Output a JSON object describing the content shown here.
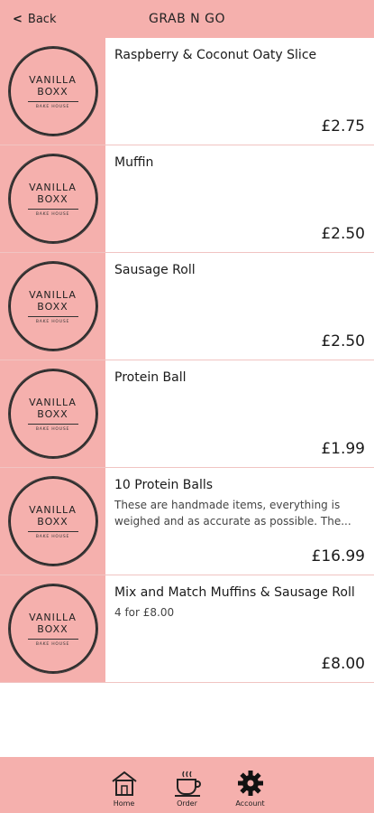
{
  "header": {
    "back_label": "Back",
    "title": "GRAB N GO"
  },
  "logo": {
    "line1": "VANILLA",
    "line2": "BOXX",
    "line3": "BAKE HOUSE"
  },
  "items": [
    {
      "name": "Raspberry & Coconut Oaty Slice",
      "desc": "",
      "price": "£2.75"
    },
    {
      "name": "Muffin",
      "desc": "",
      "price": "£2.50"
    },
    {
      "name": "Sausage Roll",
      "desc": "",
      "price": "£2.50"
    },
    {
      "name": "Protein Ball",
      "desc": "",
      "price": "£1.99"
    },
    {
      "name": "10 Protein Balls",
      "desc": "These are handmade items, everything is weighed and as accurate as possible. The...",
      "price": "£16.99"
    },
    {
      "name": "Mix and Match Muffins & Sausage Roll",
      "desc": "4 for £8.00",
      "price": "£8.00"
    }
  ],
  "tabbar": {
    "tabs": [
      {
        "label": "Home",
        "icon": "home-icon"
      },
      {
        "label": "Order",
        "icon": "coffee-cup-icon"
      },
      {
        "label": "Account",
        "icon": "gear-icon"
      }
    ]
  },
  "colors": {
    "accent": "#f5b0ad",
    "text": "#1a1a1a"
  }
}
